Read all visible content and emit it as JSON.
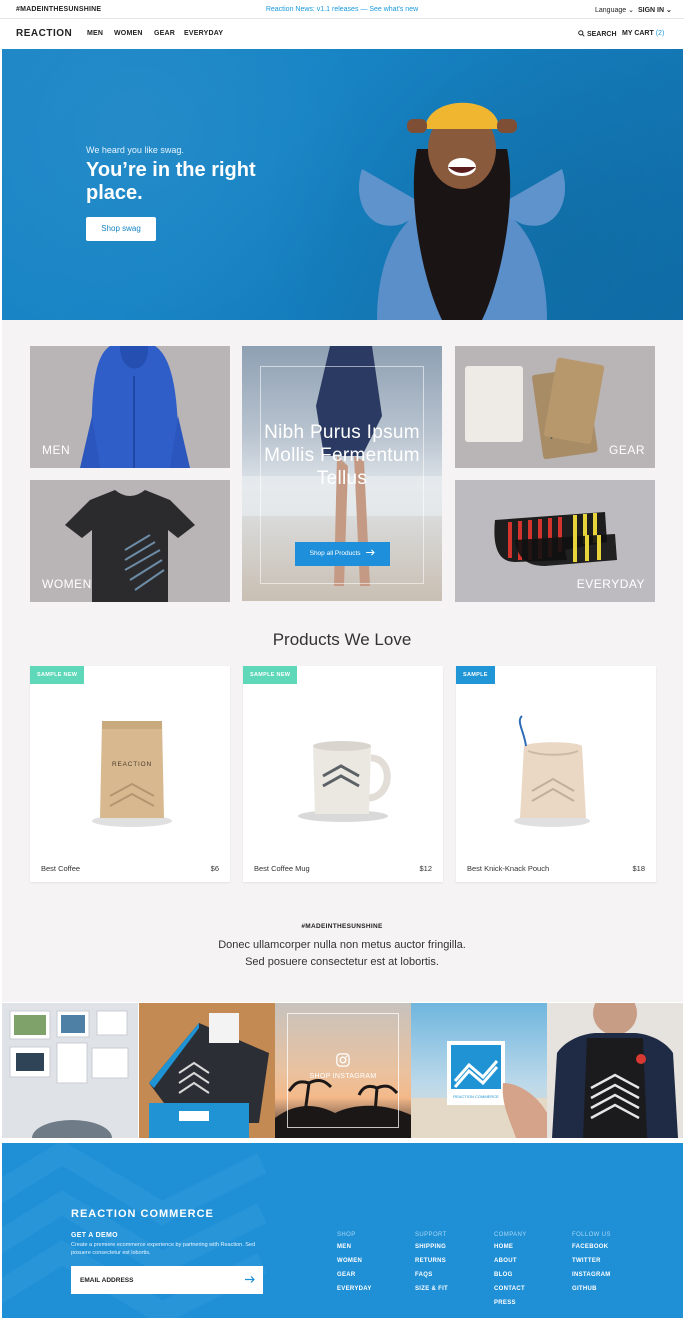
{
  "topbar": {
    "tag": "#MADEINTHESUNSHINE",
    "news": "Reaction News: v1.1 releases — See what's new",
    "language": "Language ⌄",
    "sign_in": "SIGN IN ⌄"
  },
  "nav": {
    "logo": "REACTION",
    "links": [
      "MEN",
      "WOMEN",
      "GEAR",
      "EVERYDAY"
    ],
    "search": "SEARCH",
    "cart": "MY CART",
    "cart_count": "(2)"
  },
  "hero": {
    "eyebrow": "We heard you like swag.",
    "headline": "You’re in the right place.",
    "cta": "Shop swag"
  },
  "categories": {
    "men": "MEN",
    "women": "WOMEN",
    "gear": "GEAR",
    "everyday": "EVERYDAY"
  },
  "promo": {
    "title": "Nibh Purus Ipsum Mollis Fermentum Tellus",
    "button": "Shop all Products"
  },
  "products_section": {
    "title": "Products We Love",
    "items": [
      {
        "badge": "SAMPLE NEW",
        "name": "Best Coffee",
        "price": "$6"
      },
      {
        "badge": "SAMPLE NEW",
        "name": "Best Coffee Mug",
        "price": "$12"
      },
      {
        "badge": "SAMPLE",
        "name": "Best Knick-Knack Pouch",
        "price": "$18"
      }
    ],
    "coffee_bag_label": "REACTION"
  },
  "tagline": {
    "tag": "#MADEINTHESUNSHINE",
    "line1": "Donec ullamcorper nulla non metus auctor fringilla.",
    "line2": "Sed posuere consectetur est at lobortis."
  },
  "instagram": {
    "label": "SHOP INSTAGRAM",
    "sign_text": "REACTION COMMERCE"
  },
  "footer": {
    "brand": "REACTION COMMERCE",
    "demo_heading": "GET A DEMO",
    "demo_text": "Create a premiere ecommerce experience by partnering with Reaction. Sed posuere consectetur est lobortis.",
    "email_placeholder": "EMAIL ADDRESS",
    "columns": [
      {
        "heading": "SHOP",
        "items": [
          "MEN",
          "WOMEN",
          "GEAR",
          "EVERYDAY"
        ]
      },
      {
        "heading": "SUPPORT",
        "items": [
          "SHIPPING",
          "RETURNS",
          "FAQS",
          "SIZE & FIT"
        ]
      },
      {
        "heading": "COMPANY",
        "items": [
          "HOME",
          "ABOUT",
          "BLOG",
          "CONTACT",
          "PRESS"
        ]
      },
      {
        "heading": "FOLLOW US",
        "items": [
          "FACEBOOK",
          "TWITTER",
          "INSTAGRAM",
          "GITHUB"
        ]
      }
    ]
  },
  "colors": {
    "brand_blue": "#1999dd",
    "hero_blue": "#1784c5",
    "footer_blue": "#1f8fd6",
    "badge_green": "#5ed8b8",
    "badge_blue": "#2196d6",
    "page_bg": "#f5f3f3"
  }
}
